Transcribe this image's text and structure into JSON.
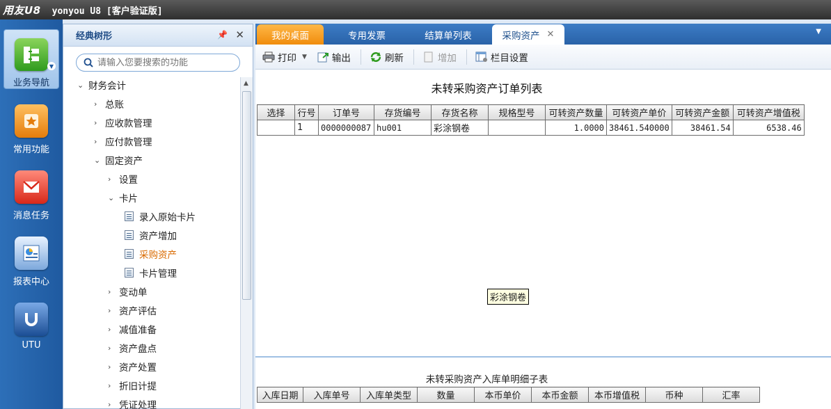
{
  "titlebar": {
    "logo": "用友U8",
    "title": "yonyou U8 [客户验证版]"
  },
  "leftnav": [
    {
      "label": "业务导航",
      "icon": "business-nav-icon",
      "active": true
    },
    {
      "label": "常用功能",
      "icon": "star-icon"
    },
    {
      "label": "消息任务",
      "icon": "message-icon"
    },
    {
      "label": "报表中心",
      "icon": "report-icon"
    },
    {
      "label": "UTU",
      "icon": "utu-icon"
    }
  ],
  "tree": {
    "header": "经典树形",
    "search_placeholder": "请输入您要搜索的功能",
    "nodes": [
      {
        "label": "财务会计",
        "level": 0,
        "expanded": true
      },
      {
        "label": "总账",
        "level": 1
      },
      {
        "label": "应收款管理",
        "level": 1
      },
      {
        "label": "应付款管理",
        "level": 1
      },
      {
        "label": "固定资产",
        "level": 1,
        "expanded": true
      },
      {
        "label": "设置",
        "level": 2
      },
      {
        "label": "卡片",
        "level": 2,
        "expanded": true
      },
      {
        "label": "录入原始卡片",
        "level": 3,
        "leaf": true
      },
      {
        "label": "资产增加",
        "level": 3,
        "leaf": true
      },
      {
        "label": "采购资产",
        "level": 3,
        "leaf": true,
        "selected": true
      },
      {
        "label": "卡片管理",
        "level": 3,
        "leaf": true
      },
      {
        "label": "变动单",
        "level": 2
      },
      {
        "label": "资产评估",
        "level": 2
      },
      {
        "label": "减值准备",
        "level": 2
      },
      {
        "label": "资产盘点",
        "level": 2
      },
      {
        "label": "资产处置",
        "level": 2
      },
      {
        "label": "折旧计提",
        "level": 2
      },
      {
        "label": "凭证处理",
        "level": 2
      }
    ]
  },
  "tabs": [
    {
      "label": "我的桌面"
    },
    {
      "label": "专用发票"
    },
    {
      "label": "结算单列表"
    },
    {
      "label": "采购资产",
      "active": true
    }
  ],
  "toolbar": {
    "print": "打印",
    "export": "输出",
    "refresh": "刷新",
    "add": "增加",
    "columns": "栏目设置"
  },
  "main": {
    "title": "未转采购资产订单列表",
    "columns": [
      "选择",
      "行号",
      "订单号",
      "存货编号",
      "存货名称",
      "规格型号",
      "可转资产数量",
      "可转资产单价",
      "可转资产金额",
      "可转资产增值税"
    ],
    "rows": [
      [
        "",
        "1",
        "0000000087",
        "hu001",
        "彩涂钢卷",
        "",
        "1.0000",
        "38461.540000",
        "38461.54",
        "6538.46"
      ]
    ],
    "tooltip": "彩涂钢卷"
  },
  "detail": {
    "title": "未转采购资产入库单明细子表",
    "columns": [
      "入库日期",
      "入库单号",
      "入库单类型",
      "数量",
      "本币单价",
      "本币金额",
      "本币增值税",
      "币种",
      "汇率"
    ]
  }
}
